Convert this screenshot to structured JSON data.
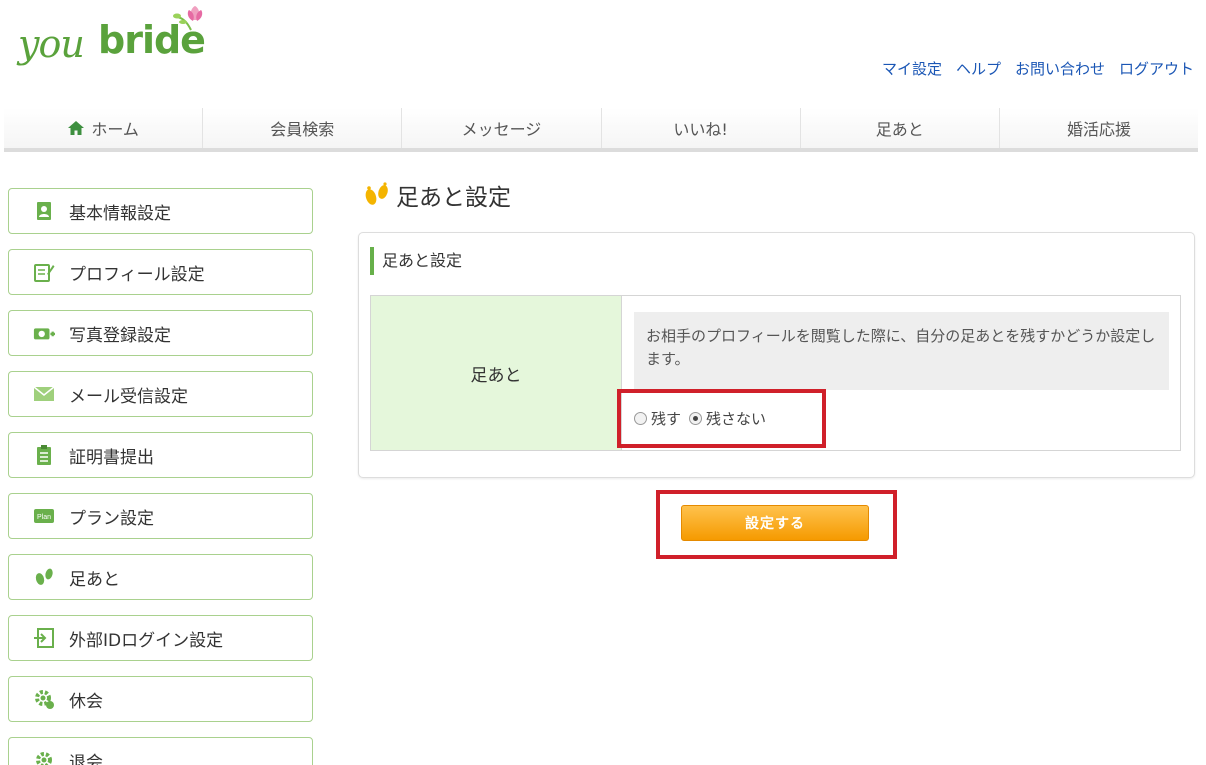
{
  "logo": {
    "part1": "you",
    "part2": "bride"
  },
  "top_links": [
    "マイ設定",
    "ヘルプ",
    "お問い合わせ",
    "ログアウト"
  ],
  "nav": [
    {
      "label": "ホーム",
      "icon": "home-icon"
    },
    {
      "label": "会員検索"
    },
    {
      "label": "メッセージ"
    },
    {
      "label": "いいね!"
    },
    {
      "label": "足あと"
    },
    {
      "label": "婚活応援"
    }
  ],
  "sidebar": {
    "items": [
      {
        "label": "基本情報設定",
        "icon": "address-book-icon"
      },
      {
        "label": "プロフィール設定",
        "icon": "edit-document-icon"
      },
      {
        "label": "写真登録設定",
        "icon": "camera-add-icon"
      },
      {
        "label": "メール受信設定",
        "icon": "mail-icon"
      },
      {
        "label": "証明書提出",
        "icon": "clipboard-icon"
      },
      {
        "label": "プラン設定",
        "icon": "plan-icon",
        "icon_text": "Plan"
      },
      {
        "label": "足あと",
        "icon": "footprints-icon"
      },
      {
        "label": "外部IDログイン設定",
        "icon": "login-icon"
      },
      {
        "label": "休会",
        "icon": "gear-pause-icon"
      },
      {
        "label": "退会",
        "icon": "gear-icon"
      }
    ]
  },
  "main": {
    "heading": "足あと設定",
    "panel_title": "足あと設定",
    "row_label": "足あと",
    "description": "お相手のプロフィールを閲覧した際に、自分の足あとを残すかどうか設定します。",
    "options": [
      {
        "label": "残す",
        "checked": false
      },
      {
        "label": "残さない",
        "checked": true
      }
    ],
    "submit_label": "設定する"
  },
  "colors": {
    "brand_green": "#5aa23c",
    "highlight_red": "#d0202a",
    "button_orange": "#f59a00",
    "label_cell_bg": "#e5f7db"
  }
}
